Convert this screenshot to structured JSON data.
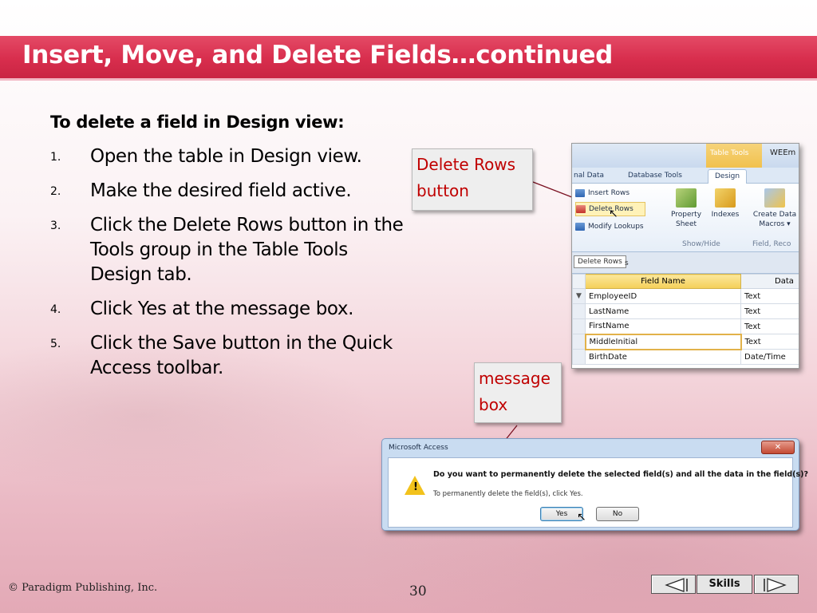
{
  "slide": {
    "title": "Insert, Move, and Delete Fields…continued",
    "heading": "To delete a field in Design view:",
    "steps": [
      {
        "num": "1.",
        "text": "Open the table in Design view."
      },
      {
        "num": "2.",
        "text": "Make the desired field active."
      },
      {
        "num": "3.",
        "text": "Click the Delete Rows button in the Tools group in the Table Tools Design tab."
      },
      {
        "num": "4.",
        "text": "Click Yes at the message box."
      },
      {
        "num": "5.",
        "text": "Click the Save button in the Quick Access toolbar."
      }
    ],
    "callouts": {
      "delete_rows": "Delete Rows button",
      "message_box": "message box"
    },
    "footer": {
      "copyright": "© Paradigm Publishing, Inc.",
      "page_number": "30",
      "skills_label": "Skills"
    }
  },
  "ribbon": {
    "contextual_tab": "Table Tools",
    "app_title": "WEEm",
    "tabs": [
      "nal Data",
      "Database Tools",
      "Design"
    ],
    "tools": [
      "Insert Rows",
      "Delete Rows",
      "Modify Lookups"
    ],
    "buttons": {
      "property_sheet": "Property Sheet",
      "indexes": "Indexes",
      "create_data_macros": "Create Data Macros ▾"
    },
    "groups": {
      "show_hide": "Show/Hide",
      "field_record": "Field, Reco"
    },
    "tooltip": "Delete Rows",
    "doc_tab_fragment": "s",
    "table": {
      "headers": [
        "Field Name",
        "Data"
      ],
      "rows": [
        {
          "name": "EmployeeID",
          "type": "Text"
        },
        {
          "name": "LastName",
          "type": "Text"
        },
        {
          "name": "FirstName",
          "type": "Text"
        },
        {
          "name": "MiddleInitial",
          "type": "Text"
        },
        {
          "name": "BirthDate",
          "type": "Date/Time"
        }
      ]
    }
  },
  "dialog": {
    "title": "Microsoft Access",
    "close_label": "✕",
    "question": "Do you want to permanently delete the selected field(s) and all the data in the field(s)?",
    "hint": "To permanently delete the field(s), click Yes.",
    "yes_label": "Yes",
    "no_label": "No"
  },
  "colors": {
    "title_bar": "#d82e4d",
    "callout_text": "#c00000",
    "warning": "#f2c21c"
  }
}
